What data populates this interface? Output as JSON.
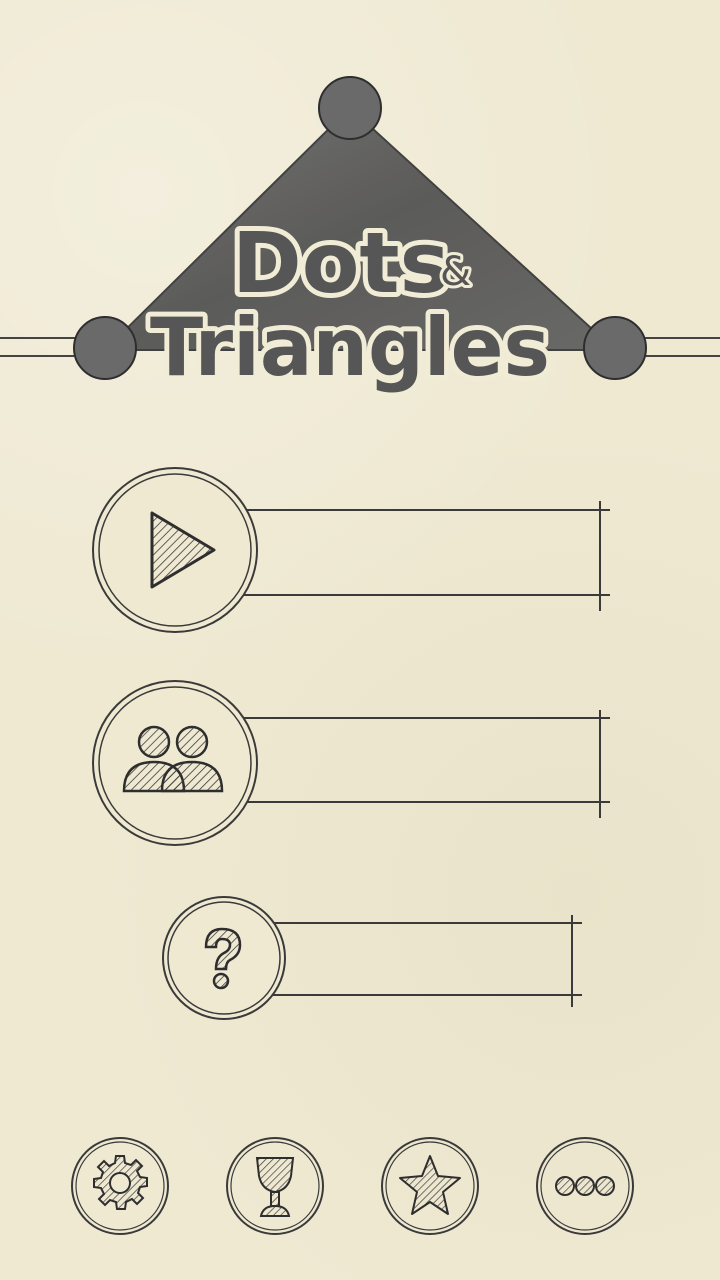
{
  "logo": {
    "line1": "Dots",
    "ampersand": "&",
    "line2": "Triangles"
  },
  "menu": {
    "play": {
      "icon": "play-icon",
      "label": ""
    },
    "multiplayer": {
      "icon": "two-players-icon",
      "label": ""
    },
    "help": {
      "icon": "question-mark-icon",
      "label": ""
    }
  },
  "bottom_bar": [
    {
      "icon": "gear-icon"
    },
    {
      "icon": "trophy-cup-icon"
    },
    {
      "icon": "star-icon"
    },
    {
      "icon": "more-dots-icon"
    }
  ],
  "colors": {
    "paper": "#efe9d2",
    "ink": "#3a3a3a",
    "watercolor": "#555555"
  }
}
